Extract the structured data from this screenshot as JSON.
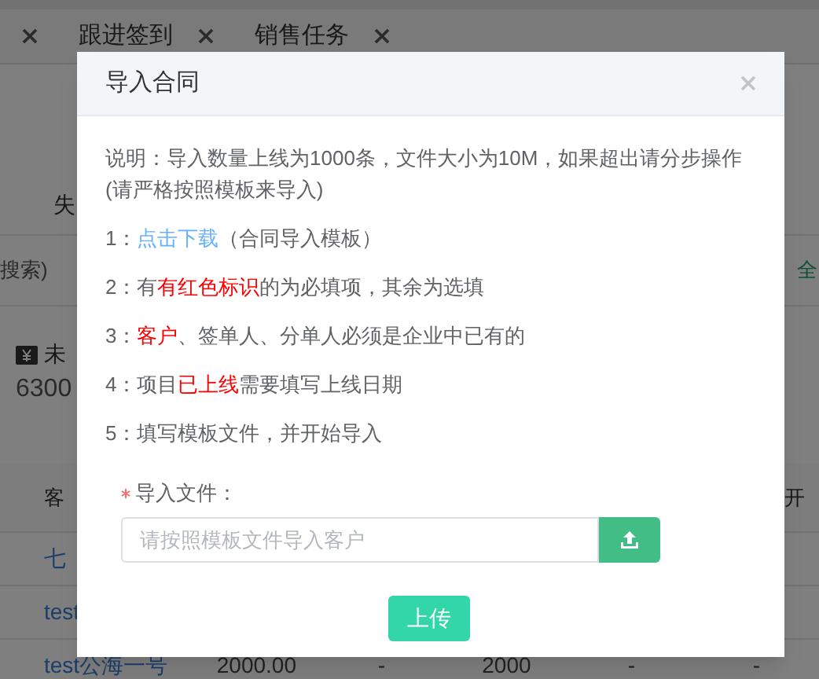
{
  "background": {
    "tabs": [
      {
        "label": "跟进签到"
      },
      {
        "label": "销售任务"
      }
    ],
    "filter_label": "失",
    "search_hint": "搜索)",
    "right_link": "全",
    "summary": {
      "label": "未",
      "value": "6300"
    },
    "table": {
      "columns": [
        "客",
        "开"
      ],
      "rows": [
        [
          "七"
        ],
        [
          "test"
        ],
        [
          "test公海一号",
          "2000.00",
          "-",
          "2000",
          "-",
          "-"
        ]
      ]
    }
  },
  "dialog": {
    "title": "导入合同",
    "intro": "说明：导入数量上线为1000条，文件大小为10M，如果超出请分步操作(请严格按照模板来导入)",
    "steps": [
      {
        "number": "1：",
        "segments": [
          {
            "kind": "link",
            "text": "点击下载"
          },
          {
            "kind": "plain",
            "text": "（合同导入模板）"
          }
        ]
      },
      {
        "number": "2：",
        "segments": [
          {
            "kind": "plain",
            "text": "有"
          },
          {
            "kind": "red",
            "text": "有红色标识"
          },
          {
            "kind": "plain",
            "text": "的为必填项，其余为选填"
          }
        ]
      },
      {
        "number": "3：",
        "segments": [
          {
            "kind": "red",
            "text": "客户"
          },
          {
            "kind": "plain",
            "text": "、签单人、分单人必须是企业中已有的"
          }
        ]
      },
      {
        "number": "4：",
        "segments": [
          {
            "kind": "plain",
            "text": "项目"
          },
          {
            "kind": "red",
            "text": "已上线"
          },
          {
            "kind": "plain",
            "text": "需要填写上线日期"
          }
        ]
      },
      {
        "number": "5：",
        "segments": [
          {
            "kind": "plain",
            "text": "填写模板文件，并开始导入"
          }
        ]
      }
    ],
    "field": {
      "label": "导入文件：",
      "required": true,
      "placeholder": "请按照模板文件导入客户"
    },
    "submit": "上传"
  }
}
